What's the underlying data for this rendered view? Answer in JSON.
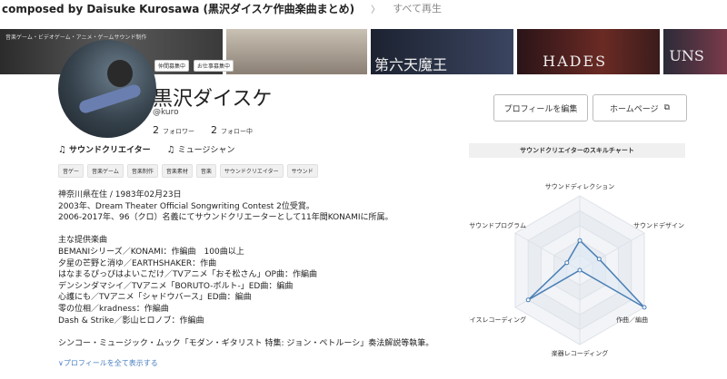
{
  "topbar": {
    "title": "composed by Daisuke Kurosawa (黒沢ダイスケ作曲楽曲まとめ)",
    "chevron": "〉",
    "play_all": "すべて再生"
  },
  "banner": {
    "tiles": [
      {
        "caption": "音楽ゲーム・ビデオゲーム・アニメ・ゲームサウンド制作"
      },
      {
        "caption": ""
      },
      {
        "caption": "第六天魔王"
      },
      {
        "caption": "HADES"
      },
      {
        "caption": "UNS"
      }
    ]
  },
  "profile": {
    "badges": [
      "仲間募集中",
      "お仕事募集中"
    ],
    "name": "黒沢ダイスケ",
    "handle": "@kuro",
    "following_count": "2",
    "following_label": "フォロワー",
    "followers_count": "2",
    "followers_label": "フォロー中",
    "edit_button": "プロフィールを編集",
    "homepage_button": "ホームページ",
    "categories": [
      "サウンドクリエイター",
      "ミュージシャン"
    ],
    "tags": [
      "音ゲー",
      "音楽ゲーム",
      "音楽制作",
      "音楽素材",
      "音楽",
      "サウンドクリエイター",
      "サウンド"
    ],
    "bio_lines": [
      "神奈川県在住 / 1983年02月23日",
      "2003年、Dream Theater Official Songwriting Contest 2位受賞。",
      "2006-2017年、96（クロ）名義にてサウンドクリエーターとして11年間KONAMIに所属。",
      "",
      "主な提供楽曲",
      "BEMANIシリーズ／KONAMI：作編曲　100曲以上",
      "夕星の芒野と消ゆ／EARTHSHAKER：作曲",
      "はなまるぴっぴはよいこだけ／TVアニメ「おそ松さん」OP曲：作編曲",
      "デンシンダマシイ／TVアニメ「BORUTO-ボルト-」ED曲：編曲",
      "心護にも／TVアニメ「シャドウバース」ED曲：編曲",
      "零の位相／kradness：作編曲",
      "Dash & Strike／影山ヒロノブ：作編曲",
      "",
      "シンコー・ミュージック・ムック「モダン・ギタリスト 特集: ジョン・ペトルーシ」奏法解説等執筆。"
    ],
    "show_more": "プロフィールを全て表示する"
  },
  "chart_data": {
    "type": "radar",
    "title": "サウンドクリエイターのスキルチャート",
    "axes": [
      "サウンドディレクション",
      "サウンドデザイン",
      "作曲／編曲",
      "楽器レコーディング",
      "ボイスレコーディング",
      "サウンドプログラム"
    ],
    "values": [
      0.4,
      0.3,
      1.0,
      0.0,
      0.8,
      0.2
    ],
    "max": 1.0,
    "rings": 5,
    "color": "#4a7fb5",
    "fill": "#dde8f3"
  }
}
